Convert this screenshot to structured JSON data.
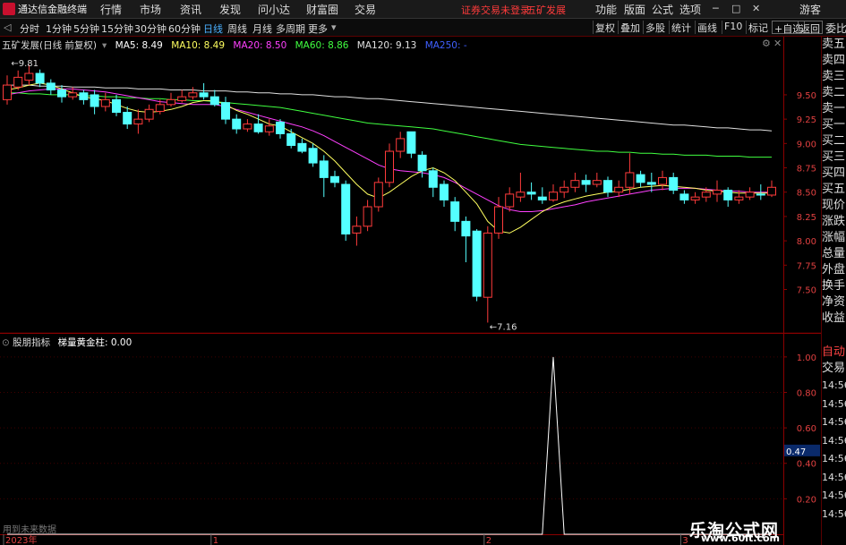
{
  "titlebar": {
    "app_title": "通达信金融终端",
    "menus": [
      "行情",
      "市场",
      "资讯",
      "发现",
      "问小达",
      "财富圈",
      "交易"
    ],
    "login_status": "证券交易未登录",
    "stock_name": "五矿发展",
    "right_menus": [
      "功能",
      "版面",
      "公式",
      "选项"
    ],
    "user": "游客",
    "window_buttons": [
      "─",
      "□",
      "✕"
    ]
  },
  "toolbar": {
    "periods": [
      "分时",
      "1分钟",
      "5分钟",
      "15分钟",
      "30分钟",
      "60分钟",
      "日线",
      "周线",
      "月线",
      "多周期",
      "更多"
    ],
    "active_period": "日线",
    "buttons": [
      "复权",
      "叠加",
      "多股",
      "统计",
      "画线",
      "F10",
      "标记",
      "+自选",
      "返回"
    ],
    "side_label": "委比"
  },
  "main_legend": {
    "stock": "五矿发展(日线 前复权)",
    "ma": [
      {
        "label": "MA5: 8.49",
        "color": "#ffffff"
      },
      {
        "label": "MA10: 8.49",
        "color": "#ffff60"
      },
      {
        "label": "MA20: 8.50",
        "color": "#ff40ff"
      },
      {
        "label": "MA60: 8.86",
        "color": "#40ff40"
      },
      {
        "label": "MA120: 9.13",
        "color": "#e0e0e0"
      },
      {
        "label": "MA250: -",
        "color": "#4060ff"
      }
    ]
  },
  "price_axis": [
    "9.50",
    "9.25",
    "9.00",
    "8.75",
    "8.50",
    "8.25",
    "8.00",
    "7.75",
    "7.50"
  ],
  "price_annotations": {
    "high": "9.81",
    "low": "7.16"
  },
  "indicator": {
    "name": "股朋指标",
    "series_label": "梯量黄金柱: 0.00",
    "axis": [
      "1.00",
      "0.80",
      "0.60",
      "0.47",
      "0.40",
      "0.20"
    ],
    "current": "0.47",
    "footnote": "用到未来数据"
  },
  "date_axis": [
    "2023年",
    "1",
    "2",
    "3"
  ],
  "right_panel": {
    "items": [
      "委比",
      "卖五",
      "卖四",
      "卖三",
      "卖二",
      "卖一",
      "买一",
      "买二",
      "买三",
      "买四",
      "买五",
      "现价",
      "涨跌",
      "涨幅",
      "总量",
      "外盘",
      "换手",
      "净资",
      "收益"
    ],
    "trade_header": [
      "自动",
      "交易"
    ],
    "times": [
      "14:56",
      "14:56",
      "14:56",
      "14:56",
      "14:56",
      "14:56",
      "14:56",
      "14:56"
    ]
  },
  "watermark": {
    "title": "乐淘公式网",
    "url": "www.60lt.com"
  },
  "colors": {
    "up": "#ff3b3b",
    "down": "#54ffff",
    "border": "#8b0000",
    "active_tab": "#4ab0ff"
  },
  "chart_data": {
    "type": "candlestick",
    "ylim": [
      7.1,
      9.95
    ],
    "candles": [
      {
        "o": 9.45,
        "c": 9.6,
        "h": 9.7,
        "l": 9.4
      },
      {
        "o": 9.58,
        "c": 9.68,
        "h": 9.75,
        "l": 9.55
      },
      {
        "o": 9.65,
        "c": 9.72,
        "h": 9.81,
        "l": 9.6
      },
      {
        "o": 9.72,
        "c": 9.62,
        "h": 9.76,
        "l": 9.58
      },
      {
        "o": 9.62,
        "c": 9.55,
        "h": 9.66,
        "l": 9.5
      },
      {
        "o": 9.55,
        "c": 9.48,
        "h": 9.6,
        "l": 9.42
      },
      {
        "o": 9.48,
        "c": 9.52,
        "h": 9.58,
        "l": 9.45
      },
      {
        "o": 9.52,
        "c": 9.45,
        "h": 9.55,
        "l": 9.4
      },
      {
        "o": 9.5,
        "c": 9.38,
        "h": 9.55,
        "l": 9.3
      },
      {
        "o": 9.38,
        "c": 9.45,
        "h": 9.52,
        "l": 9.33
      },
      {
        "o": 9.45,
        "c": 9.32,
        "h": 9.5,
        "l": 9.28
      },
      {
        "o": 9.32,
        "c": 9.2,
        "h": 9.38,
        "l": 9.15
      },
      {
        "o": 9.2,
        "c": 9.25,
        "h": 9.35,
        "l": 9.1
      },
      {
        "o": 9.25,
        "c": 9.35,
        "h": 9.4,
        "l": 9.22
      },
      {
        "o": 9.33,
        "c": 9.4,
        "h": 9.45,
        "l": 9.3
      },
      {
        "o": 9.4,
        "c": 9.45,
        "h": 9.52,
        "l": 9.38
      },
      {
        "o": 9.44,
        "c": 9.48,
        "h": 9.55,
        "l": 9.42
      },
      {
        "o": 9.48,
        "c": 9.52,
        "h": 9.58,
        "l": 9.45
      },
      {
        "o": 9.52,
        "c": 9.48,
        "h": 9.62,
        "l": 9.45
      },
      {
        "o": 9.48,
        "c": 9.4,
        "h": 9.55,
        "l": 9.38
      },
      {
        "o": 9.42,
        "c": 9.25,
        "h": 9.48,
        "l": 9.2
      },
      {
        "o": 9.25,
        "c": 9.15,
        "h": 9.3,
        "l": 9.1
      },
      {
        "o": 9.15,
        "c": 9.2,
        "h": 9.25,
        "l": 9.12
      },
      {
        "o": 9.2,
        "c": 9.12,
        "h": 9.3,
        "l": 9.1
      },
      {
        "o": 9.12,
        "c": 9.18,
        "h": 9.25,
        "l": 9.08
      },
      {
        "o": 9.22,
        "c": 9.1,
        "h": 9.25,
        "l": 9.05
      },
      {
        "o": 9.1,
        "c": 8.98,
        "h": 9.15,
        "l": 8.95
      },
      {
        "o": 9.0,
        "c": 8.92,
        "h": 9.05,
        "l": 8.9
      },
      {
        "o": 8.95,
        "c": 8.8,
        "h": 9.0,
        "l": 8.76
      },
      {
        "o": 8.82,
        "c": 8.65,
        "h": 8.88,
        "l": 8.45
      },
      {
        "o": 8.66,
        "c": 8.6,
        "h": 8.72,
        "l": 8.55
      },
      {
        "o": 8.58,
        "c": 8.07,
        "h": 8.62,
        "l": 8.0
      },
      {
        "o": 8.08,
        "c": 8.15,
        "h": 8.25,
        "l": 7.95
      },
      {
        "o": 8.15,
        "c": 8.35,
        "h": 8.42,
        "l": 8.1
      },
      {
        "o": 8.35,
        "c": 8.6,
        "h": 8.65,
        "l": 8.3
      },
      {
        "o": 8.6,
        "c": 8.92,
        "h": 9.0,
        "l": 8.55
      },
      {
        "o": 8.92,
        "c": 9.05,
        "h": 9.12,
        "l": 8.85
      },
      {
        "o": 9.12,
        "c": 8.9,
        "h": 9.12,
        "l": 8.85
      },
      {
        "o": 8.88,
        "c": 8.72,
        "h": 8.92,
        "l": 8.65
      },
      {
        "o": 8.72,
        "c": 8.55,
        "h": 8.75,
        "l": 8.45
      },
      {
        "o": 8.58,
        "c": 8.42,
        "h": 8.62,
        "l": 8.35
      },
      {
        "o": 8.4,
        "c": 8.2,
        "h": 8.45,
        "l": 8.1
      },
      {
        "o": 8.2,
        "c": 8.05,
        "h": 8.25,
        "l": 7.78
      },
      {
        "o": 8.1,
        "c": 7.43,
        "h": 8.12,
        "l": 7.38
      },
      {
        "o": 7.42,
        "c": 8.08,
        "h": 8.15,
        "l": 7.16
      },
      {
        "o": 8.08,
        "c": 8.35,
        "h": 8.45,
        "l": 8.02
      },
      {
        "o": 8.35,
        "c": 8.48,
        "h": 8.55,
        "l": 8.3
      },
      {
        "o": 8.45,
        "c": 8.5,
        "h": 8.7,
        "l": 8.4
      },
      {
        "o": 8.5,
        "c": 8.48,
        "h": 8.6,
        "l": 8.42
      },
      {
        "o": 8.45,
        "c": 8.42,
        "h": 8.55,
        "l": 8.38
      },
      {
        "o": 8.42,
        "c": 8.5,
        "h": 8.58,
        "l": 8.4
      },
      {
        "o": 8.5,
        "c": 8.55,
        "h": 8.62,
        "l": 8.44
      },
      {
        "o": 8.55,
        "c": 8.62,
        "h": 8.7,
        "l": 8.5
      },
      {
        "o": 8.62,
        "c": 8.58,
        "h": 8.68,
        "l": 8.5
      },
      {
        "o": 8.58,
        "c": 8.62,
        "h": 8.7,
        "l": 8.55
      },
      {
        "o": 8.62,
        "c": 8.5,
        "h": 8.66,
        "l": 8.45
      },
      {
        "o": 8.5,
        "c": 8.55,
        "h": 8.62,
        "l": 8.45
      },
      {
        "o": 8.55,
        "c": 8.7,
        "h": 8.9,
        "l": 8.48
      },
      {
        "o": 8.68,
        "c": 8.6,
        "h": 8.72,
        "l": 8.55
      },
      {
        "o": 8.6,
        "c": 8.58,
        "h": 8.7,
        "l": 8.5
      },
      {
        "o": 8.58,
        "c": 8.65,
        "h": 8.72,
        "l": 8.52
      },
      {
        "o": 8.65,
        "c": 8.52,
        "h": 8.7,
        "l": 8.48
      },
      {
        "o": 8.48,
        "c": 8.42,
        "h": 8.52,
        "l": 8.38
      },
      {
        "o": 8.42,
        "c": 8.45,
        "h": 8.5,
        "l": 8.38
      },
      {
        "o": 8.45,
        "c": 8.5,
        "h": 8.55,
        "l": 8.4
      },
      {
        "o": 8.48,
        "c": 8.52,
        "h": 8.62,
        "l": 8.4
      },
      {
        "o": 8.52,
        "c": 8.42,
        "h": 8.55,
        "l": 8.35
      },
      {
        "o": 8.42,
        "c": 8.45,
        "h": 8.52,
        "l": 8.38
      },
      {
        "o": 8.45,
        "c": 8.5,
        "h": 8.55,
        "l": 8.42
      },
      {
        "o": 8.48,
        "c": 8.47,
        "h": 8.58,
        "l": 8.42
      },
      {
        "o": 8.47,
        "c": 8.55,
        "h": 8.62,
        "l": 8.45
      }
    ],
    "ma10": [
      9.55,
      9.57,
      9.6,
      9.62,
      9.6,
      9.56,
      9.52,
      9.48,
      9.46,
      9.44,
      9.4,
      9.36,
      9.33,
      9.32,
      9.33,
      9.35,
      9.38,
      9.42,
      9.44,
      9.44,
      9.4,
      9.34,
      9.3,
      9.25,
      9.2,
      9.18,
      9.12,
      9.06,
      9.0,
      8.92,
      8.82,
      8.7,
      8.58,
      8.48,
      8.44,
      8.5,
      8.58,
      8.66,
      8.72,
      8.75,
      8.7,
      8.62,
      8.5,
      8.38,
      8.2,
      8.1,
      8.08,
      8.14,
      8.22,
      8.3,
      8.36,
      8.4,
      8.43,
      8.46,
      8.48,
      8.5,
      8.51,
      8.53,
      8.55,
      8.56,
      8.57,
      8.56,
      8.55,
      8.54,
      8.52,
      8.51,
      8.5,
      8.49,
      8.49,
      8.49,
      8.49
    ],
    "ma20": [
      9.5,
      9.52,
      9.54,
      9.55,
      9.56,
      9.56,
      9.56,
      9.55,
      9.54,
      9.53,
      9.51,
      9.49,
      9.47,
      9.45,
      9.43,
      9.42,
      9.41,
      9.4,
      9.4,
      9.4,
      9.38,
      9.35,
      9.32,
      9.29,
      9.26,
      9.23,
      9.2,
      9.17,
      9.13,
      9.08,
      9.02,
      8.96,
      8.9,
      8.84,
      8.78,
      8.74,
      8.72,
      8.71,
      8.7,
      8.68,
      8.65,
      8.6,
      8.54,
      8.48,
      8.42,
      8.36,
      8.32,
      8.3,
      8.3,
      8.31,
      8.33,
      8.35,
      8.37,
      8.4,
      8.42,
      8.44,
      8.46,
      8.48,
      8.5,
      8.52,
      8.53,
      8.54,
      8.54,
      8.54,
      8.53,
      8.52,
      8.51,
      8.51,
      8.5,
      8.5,
      8.5
    ],
    "ma60": [
      9.52,
      9.52,
      9.51,
      9.51,
      9.5,
      9.5,
      9.5,
      9.49,
      9.49,
      9.48,
      9.48,
      9.47,
      9.47,
      9.46,
      9.46,
      9.45,
      9.45,
      9.44,
      9.44,
      9.43,
      9.42,
      9.41,
      9.4,
      9.39,
      9.38,
      9.37,
      9.35,
      9.33,
      9.31,
      9.29,
      9.27,
      9.25,
      9.23,
      9.21,
      9.2,
      9.19,
      9.18,
      9.17,
      9.16,
      9.15,
      9.13,
      9.11,
      9.09,
      9.07,
      9.05,
      9.03,
      9.01,
      8.99,
      8.98,
      8.97,
      8.96,
      8.95,
      8.94,
      8.93,
      8.92,
      8.92,
      8.91,
      8.91,
      8.9,
      8.9,
      8.89,
      8.89,
      8.88,
      8.88,
      8.88,
      8.87,
      8.87,
      8.87,
      8.86,
      8.86,
      8.86
    ],
    "ma120": [
      9.6,
      9.6,
      9.6,
      9.59,
      9.59,
      9.59,
      9.58,
      9.58,
      9.58,
      9.57,
      9.57,
      9.57,
      9.56,
      9.56,
      9.56,
      9.55,
      9.55,
      9.55,
      9.54,
      9.54,
      9.54,
      9.53,
      9.53,
      9.52,
      9.52,
      9.51,
      9.51,
      9.5,
      9.5,
      9.49,
      9.48,
      9.48,
      9.47,
      9.46,
      9.46,
      9.45,
      9.44,
      9.43,
      9.42,
      9.41,
      9.4,
      9.39,
      9.38,
      9.37,
      9.36,
      9.35,
      9.34,
      9.33,
      9.32,
      9.31,
      9.3,
      9.29,
      9.28,
      9.27,
      9.26,
      9.25,
      9.24,
      9.23,
      9.22,
      9.21,
      9.2,
      9.19,
      9.19,
      9.18,
      9.17,
      9.16,
      9.16,
      9.15,
      9.14,
      9.14,
      9.13
    ],
    "indicator_values": [
      0,
      0,
      0,
      0,
      0,
      0,
      0,
      0,
      0,
      0,
      0,
      0,
      0,
      0,
      0,
      0,
      0,
      0,
      0,
      0,
      0,
      0,
      0,
      0,
      0,
      0,
      0,
      0,
      0,
      0,
      0,
      0,
      0,
      0,
      0,
      0,
      0,
      0,
      0,
      0,
      0,
      0,
      0,
      0,
      0,
      0,
      0,
      0,
      0,
      0,
      1,
      0,
      0,
      0,
      0,
      0,
      0,
      0,
      0,
      0,
      0,
      0,
      0,
      0,
      0,
      0,
      0,
      0,
      0,
      0,
      0
    ],
    "indicator_ylim": [
      0,
      1.08
    ]
  }
}
